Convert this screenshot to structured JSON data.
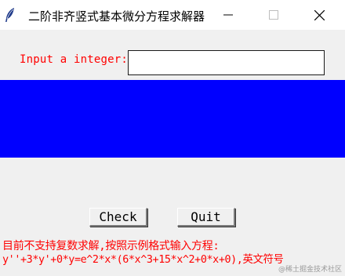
{
  "window": {
    "title": "二阶非齐竖式基本微分方程求解器",
    "icon": "feather-icon",
    "controls": [
      "minimize-icon",
      "maximize-icon",
      "close-icon"
    ]
  },
  "form": {
    "input_label": "Input a integer:",
    "input_value": "",
    "input_placeholder": ""
  },
  "buttons": {
    "check_label": "Check",
    "quit_label": "Quit"
  },
  "notes": {
    "line1": "目前不支持复数求解,按照示例格式输入方程:",
    "line2": "y''+3*y'+0*y=e^2*x*(6*x^3+15*x^2+0*x+0),英文符号"
  },
  "watermark": "@稀土掘金技术社区",
  "colors": {
    "label_text": "#ff0000",
    "panel_background": "#0000ff",
    "window_background": "#f0f0f0"
  }
}
